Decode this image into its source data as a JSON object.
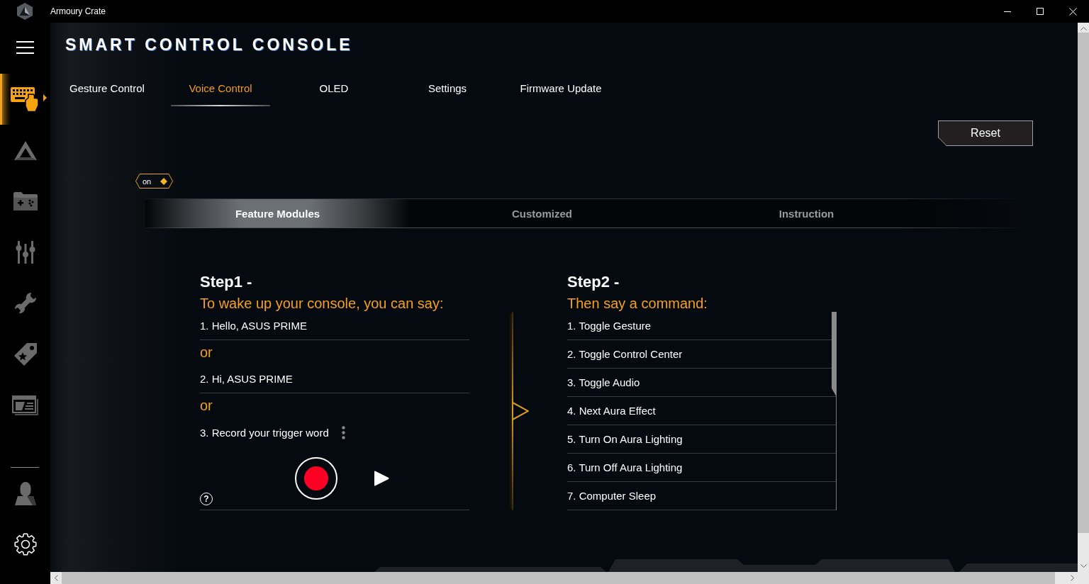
{
  "window": {
    "title": "Armoury Crate"
  },
  "sidebar": {
    "items": [
      {
        "selected": true
      },
      {
        "selected": false
      },
      {
        "selected": false
      },
      {
        "selected": false
      },
      {
        "selected": false
      },
      {
        "selected": false
      },
      {
        "selected": false
      }
    ]
  },
  "page_title": "SMART CONTROL CONSOLE",
  "tabs": [
    {
      "label": "Gesture Control",
      "selected": false
    },
    {
      "label": "Voice Control",
      "selected": true
    },
    {
      "label": "OLED",
      "selected": false
    },
    {
      "label": "Settings",
      "selected": false
    },
    {
      "label": "Firmware Update",
      "selected": false
    }
  ],
  "reset_button": "Reset",
  "voice_toggle": {
    "label": "on",
    "on": true
  },
  "sub_tabs": [
    {
      "label": "Feature Modules",
      "selected": true
    },
    {
      "label": "Customized",
      "selected": false
    },
    {
      "label": "Instruction",
      "selected": false
    }
  ],
  "step1": {
    "heading": "Step1 -",
    "subtitle": "To wake up your console, you can say:",
    "items": [
      {
        "kind": "phrase",
        "text": "1. Hello, ASUS PRIME"
      },
      {
        "kind": "separator",
        "text": "or"
      },
      {
        "kind": "phrase",
        "text": "2. Hi, ASUS PRIME"
      },
      {
        "kind": "separator",
        "text": "or"
      },
      {
        "kind": "record",
        "text": "3. Record your trigger word"
      }
    ],
    "help_button": "?"
  },
  "step2": {
    "heading": "Step2 -",
    "subtitle": "Then say a command:",
    "commands": [
      "1. Toggle Gesture",
      "2. Toggle Control Center",
      "3. Toggle Audio",
      "4. Next Aura Effect",
      "5. Turn On Aura Lighting",
      "6. Turn Off Aura Lighting",
      "7. Computer Sleep"
    ]
  }
}
